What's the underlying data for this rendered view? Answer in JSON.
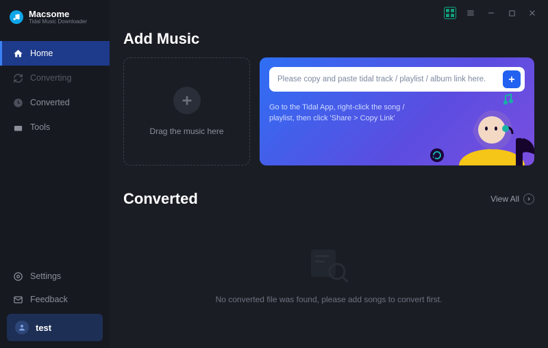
{
  "brand": {
    "name": "Macsome",
    "sub": "Tidal Music Downloader"
  },
  "nav": {
    "home": "Home",
    "converting": "Converting",
    "converted": "Converted",
    "tools": "Tools"
  },
  "footer": {
    "settings": "Settings",
    "feedback": "Feedback",
    "user": "test"
  },
  "sections": {
    "add_title": "Add Music",
    "converted_title": "Converted"
  },
  "drop": {
    "label": "Drag the music here"
  },
  "linkcard": {
    "placeholder": "Please copy and paste tidal track / playlist / album link here.",
    "hint": "Go to the Tidal App, right-click the song / playlist, then click 'Share > Copy Link'"
  },
  "converted": {
    "view_all": "View All",
    "empty": "No converted file was found, please add songs to convert first."
  }
}
